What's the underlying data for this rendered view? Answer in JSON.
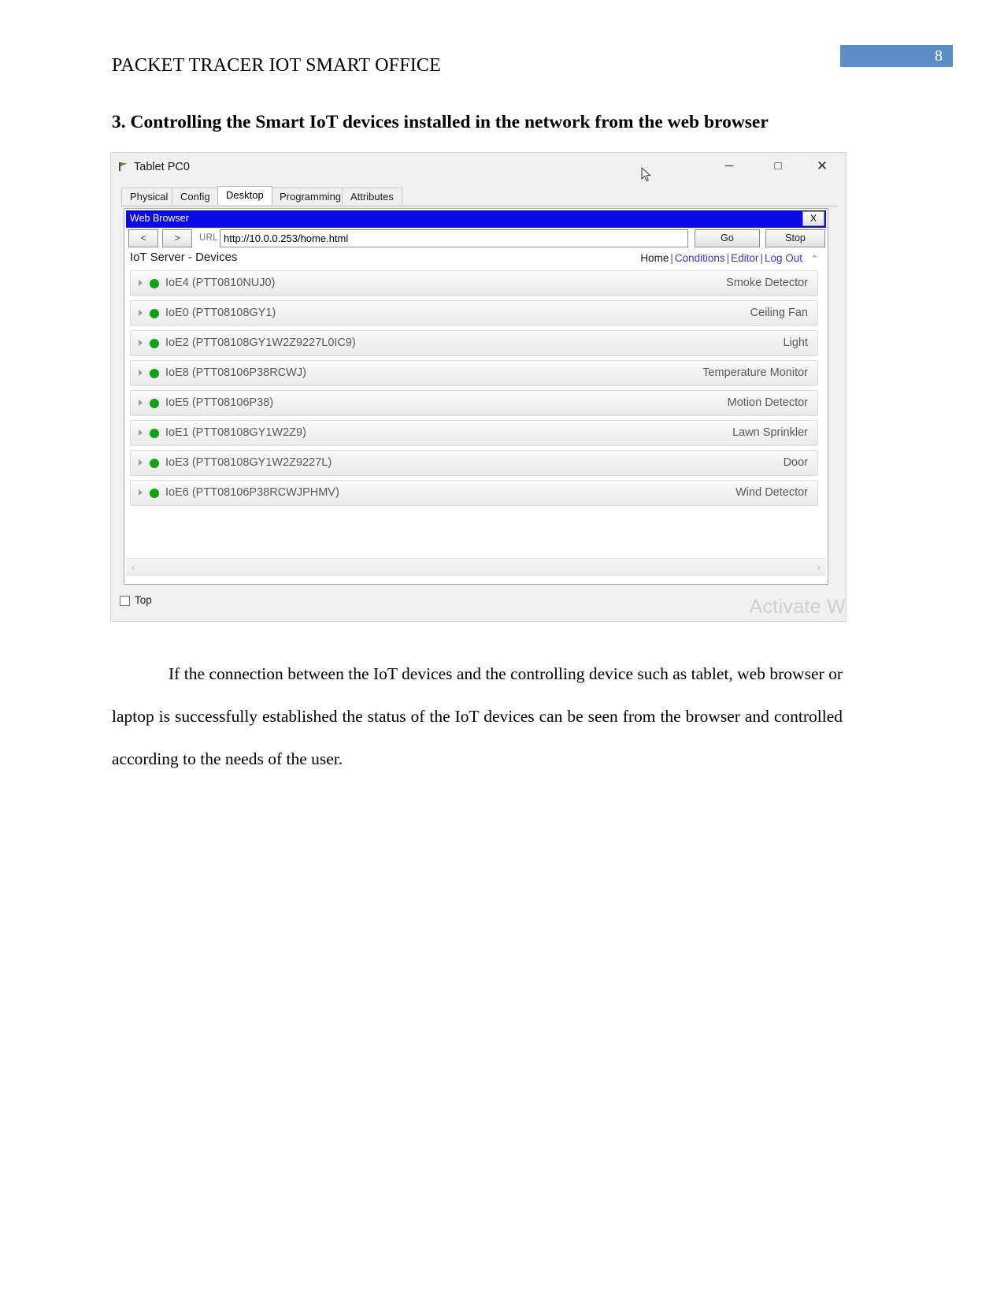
{
  "document": {
    "running_head": "PACKET TRACER IOT SMART OFFICE",
    "page_number": "8",
    "page_number_bg": "#5b8dc8",
    "section_heading": "3. Controlling the Smart IoT devices installed in the network from the web browser",
    "body_paragraph": "If the connection between the IoT devices and the controlling device such as tablet, web browser or laptop is successfully established the status of the IoT devices can be seen from the browser and controlled according to the needs of the user."
  },
  "window": {
    "title": "Tablet PC0",
    "minimize_label": "─",
    "maximize_label": "□",
    "close_label": "✕",
    "tabs": [
      {
        "label": "Physical",
        "active": false
      },
      {
        "label": "Config",
        "active": false
      },
      {
        "label": "Desktop",
        "active": true
      },
      {
        "label": "Programming",
        "active": false
      },
      {
        "label": "Attributes",
        "active": false
      }
    ],
    "bottom": {
      "top_checkbox_label": "Top",
      "top_checkbox_checked": false,
      "watermark": "Activate W"
    }
  },
  "browser": {
    "title": "Web Browser",
    "title_bg": "#0a0ae8",
    "close_label": "X",
    "back_label": "<",
    "forward_label": ">",
    "url_label": "URL",
    "url_value": "http://10.0.0.253/home.html",
    "url_placeholder": "http://",
    "go_label": "Go",
    "stop_label": "Stop"
  },
  "iot_page": {
    "brand": "IoT Server - Devices",
    "nav": {
      "home": "Home",
      "conditions": "Conditions",
      "editor": "Editor",
      "logout": "Log Out",
      "separator": "|",
      "link_color": "#3b35d6"
    },
    "status_color": "#13a013",
    "scroll_up_caret": "⌃",
    "scroll_left_arrow": "‹",
    "scroll_right_arrow": "›",
    "devices": [
      {
        "name": "IoE4 (PTT0810NUJ0)",
        "type": "Smoke Detector",
        "status": "on"
      },
      {
        "name": "IoE0 (PTT08108GY1)",
        "type": "Ceiling Fan",
        "status": "on"
      },
      {
        "name": "IoE2 (PTT08108GY1W2Z9227L0IC9)",
        "type": "Light",
        "status": "on"
      },
      {
        "name": "IoE8 (PTT08106P38RCWJ)",
        "type": "Temperature Monitor",
        "status": "on"
      },
      {
        "name": "IoE5 (PTT08106P38)",
        "type": "Motion Detector",
        "status": "on"
      },
      {
        "name": "IoE1 (PTT08108GY1W2Z9)",
        "type": "Lawn Sprinkler",
        "status": "on"
      },
      {
        "name": "IoE3 (PTT08108GY1W2Z9227L)",
        "type": "Door",
        "status": "on"
      },
      {
        "name": "IoE6 (PTT08106P38RCWJPHMV)",
        "type": "Wind Detector",
        "status": "on"
      }
    ]
  }
}
